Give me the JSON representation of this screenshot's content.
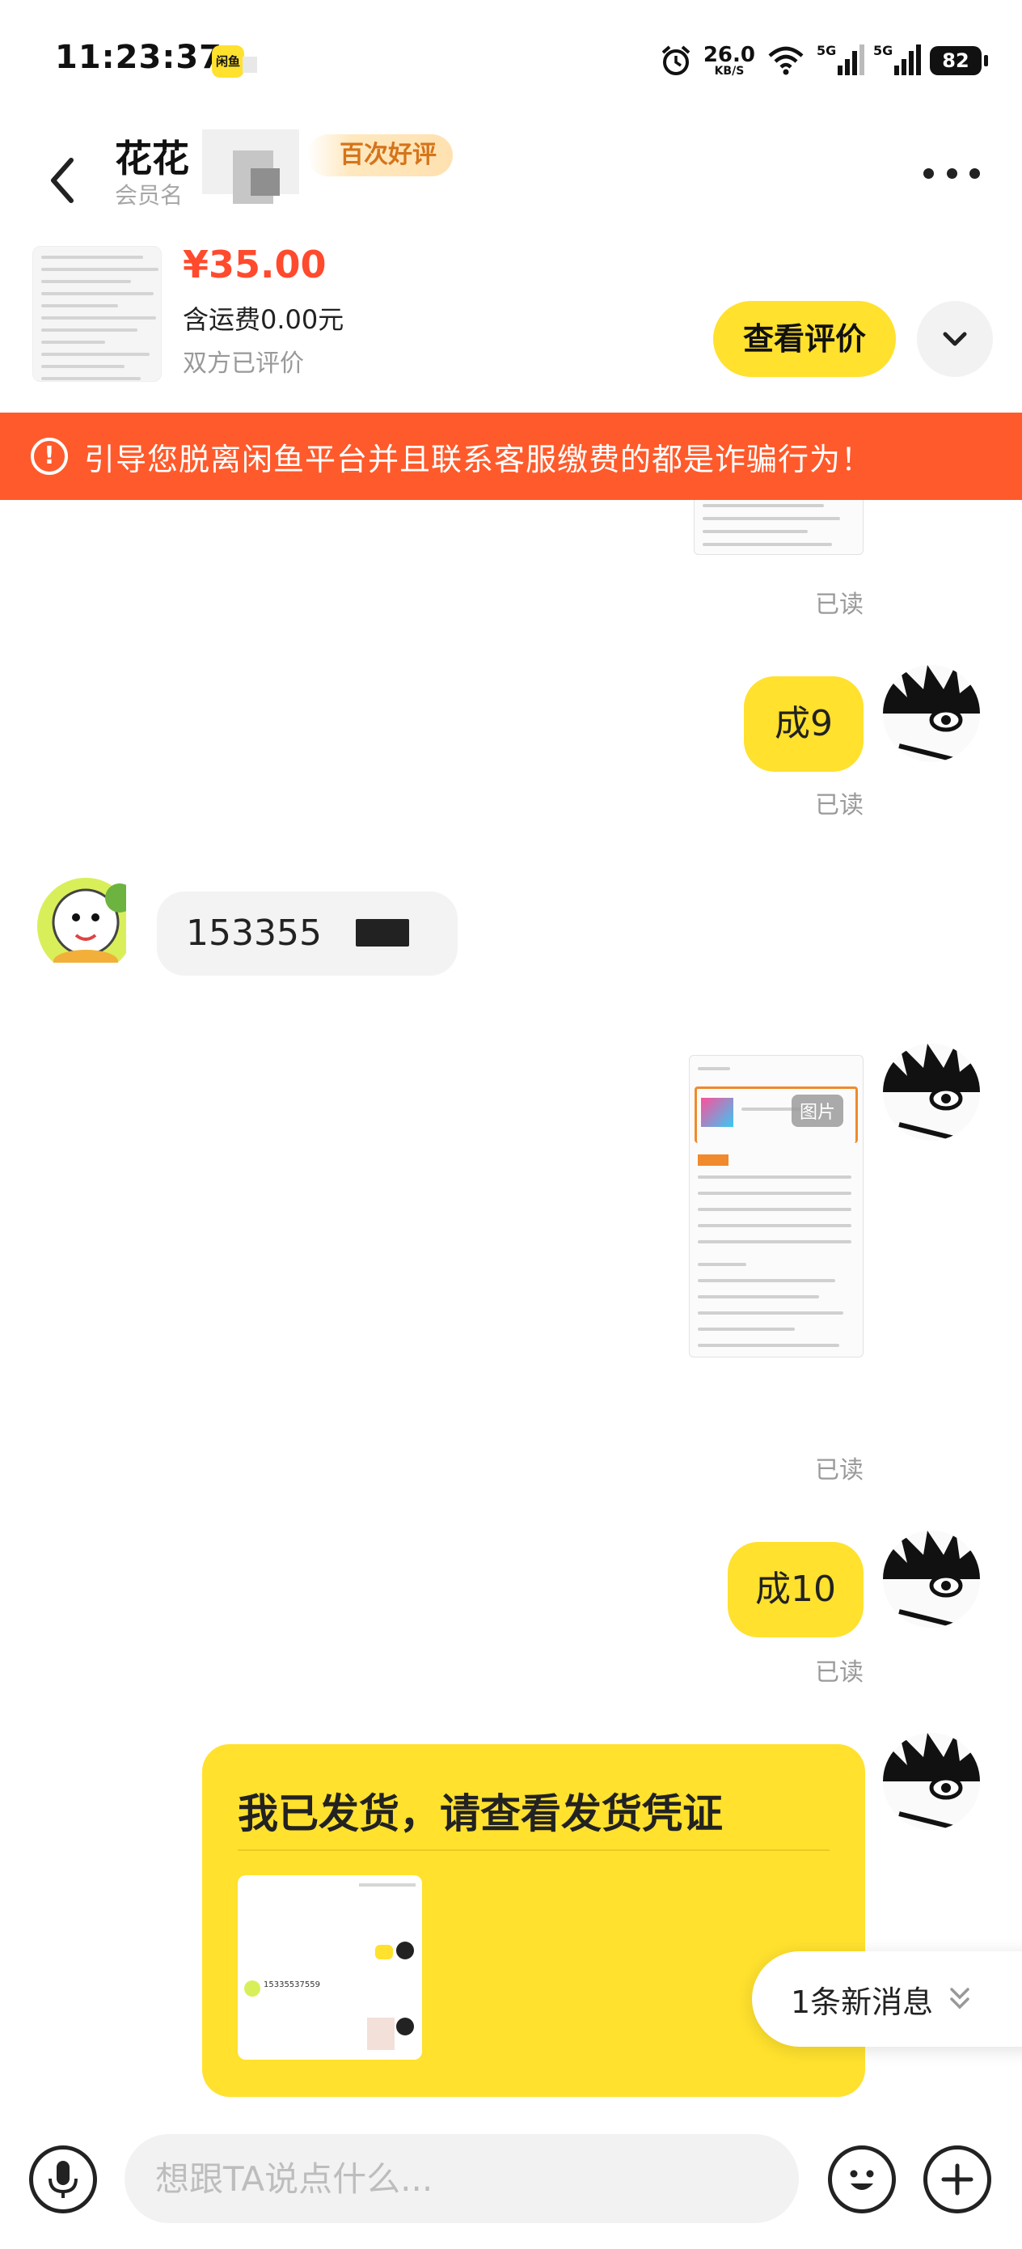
{
  "status_bar": {
    "time": "11:23:37",
    "app_badge": "闲鱼",
    "net_speed": "26.0",
    "net_unit": "KB/S",
    "sim1": "5G",
    "sim2": "5G",
    "battery": "82",
    "icons": [
      "alarm-icon",
      "wifi-icon",
      "signal-icon",
      "battery-icon"
    ]
  },
  "header": {
    "peer_name": "花花",
    "peer_sub": "会员名",
    "praise_badge": "百次好评",
    "icons": [
      "back-arrow-icon",
      "more-icon"
    ]
  },
  "item": {
    "price": "¥35.00",
    "shipping": "含运费0.00元",
    "status": "双方已评价",
    "review_button": "查看评价",
    "icons": [
      "chevron-down-icon"
    ]
  },
  "warning": {
    "icon": "!",
    "text": "引导您脱离闲鱼平台并且联系客服缴费的都是诈骗行为！"
  },
  "chat": {
    "read_label": "已读",
    "messages": [
      {
        "from": "me",
        "type": "text",
        "text": "成9"
      },
      {
        "from": "peer",
        "type": "text",
        "text": "153355"
      },
      {
        "from": "me",
        "type": "image",
        "tag": "图片"
      },
      {
        "from": "me",
        "type": "text",
        "text": "成10"
      },
      {
        "from": "me",
        "type": "card",
        "title": "我已发货，请查看发货凭证"
      }
    ],
    "proof_number": "15335537559",
    "new_message": "1条新消息"
  },
  "input": {
    "placeholder": "想跟TA说点什么...",
    "icons": [
      "mic-icon",
      "emoji-icon",
      "plus-icon"
    ]
  },
  "colors": {
    "accent_yellow": "#ffe12e",
    "warning_red": "#ff5a2b",
    "price_red": "#ff4a2d"
  }
}
